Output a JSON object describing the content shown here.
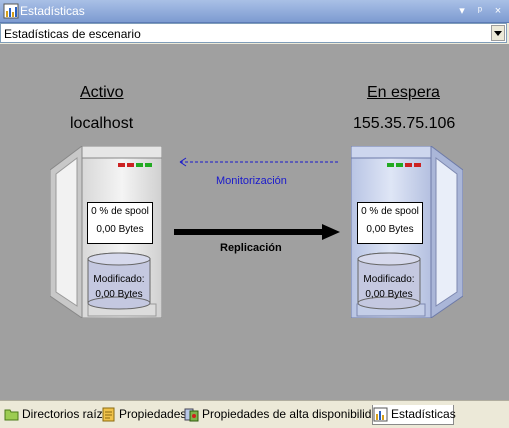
{
  "window": {
    "title": "Estadísticas",
    "controls": {
      "menu": "▾",
      "pin": "ᵖ",
      "close": "×"
    }
  },
  "scenario_select": {
    "value": "Estadísticas de escenario"
  },
  "active": {
    "role": "Activo",
    "host": "localhost",
    "spool": "0 % de spool",
    "spool_bytes": "0,00 Bytes",
    "modified_label": "Modificado:",
    "modified_bytes": "0,00 Bytes",
    "leds": [
      "#cc2222",
      "#cc2222",
      "#22aa22",
      "#22aa22"
    ]
  },
  "standby": {
    "role": "En espera",
    "host": "155.35.75.106",
    "spool": "0 % de spool",
    "spool_bytes": "0,00 Bytes",
    "modified_label": "Modificado:",
    "modified_bytes": "0,00 Bytes",
    "leds": [
      "#22aa22",
      "#22aa22",
      "#cc2222",
      "#cc2222"
    ]
  },
  "links": {
    "monitoring": "Monitorización",
    "replication": "Replicación"
  },
  "tabs": [
    {
      "label": "Directorios raíz",
      "icon": "folder-icon"
    },
    {
      "label": "Propiedades",
      "icon": "properties-icon"
    },
    {
      "label": "Propiedades de alta disponibilidad",
      "icon": "ha-properties-icon"
    },
    {
      "label": "Estadísticas",
      "icon": "statistics-icon",
      "active": true
    }
  ],
  "colors": {
    "titlebar": "#7d9bd1",
    "canvas": "#a0a0a0",
    "active_server": "#e6e6e6",
    "standby_server": "#c9d3ec",
    "monitor_arrow": "#1a1acc"
  }
}
